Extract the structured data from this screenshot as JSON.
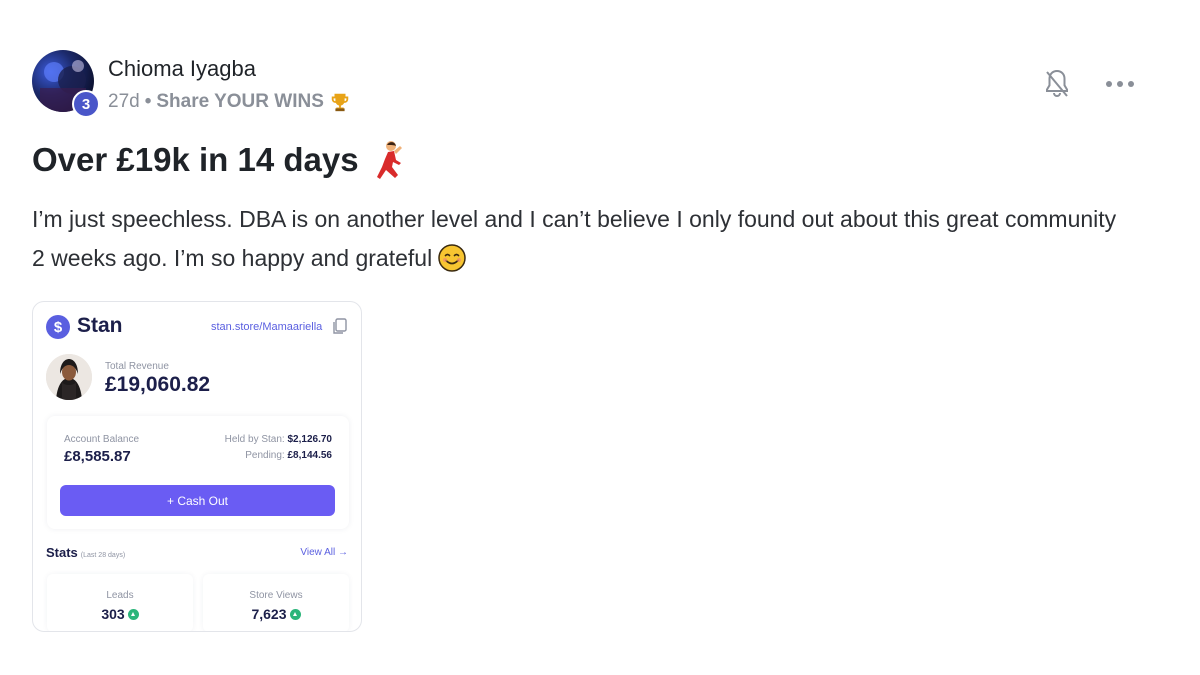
{
  "post": {
    "author": "Chioma Iyagba",
    "level": "3",
    "time_ago": "27d",
    "separator": "•",
    "category": "Share YOUR WINS",
    "title": "Over £19k in 14 days",
    "body": "I’m just speechless. DBA is on another level and I can’t believe I only found out about this great community 2 weeks ago. I’m so happy and grateful"
  },
  "icons": {
    "trophy": "trophy-icon",
    "dancer": "dancer-icon",
    "smile": "smiling-face-icon",
    "bell": "bell-off-icon",
    "more": "more-options-icon"
  },
  "stan_card": {
    "brand": "Stan",
    "logo_glyph": "$",
    "url": "stan.store/Mamaariella",
    "total_revenue_label": "Total Revenue",
    "total_revenue": "£19,060.82",
    "account_balance_label": "Account Balance",
    "account_balance": "£8,585.87",
    "held_label": "Held by Stan:",
    "held_value": "$2,126.70",
    "pending_label": "Pending:",
    "pending_value": "£8,144.56",
    "cash_out_label": "+ Cash Out",
    "stats_title": "Stats",
    "stats_subtitle": "(Last 28 days)",
    "view_all": "View All →",
    "leads_label": "Leads",
    "leads_value": "303",
    "store_views_label": "Store Views",
    "store_views_value": "7,623"
  },
  "colors": {
    "accent": "#6a5cf3",
    "level_badge": "#4a56c9",
    "positive": "#2bb57a"
  }
}
